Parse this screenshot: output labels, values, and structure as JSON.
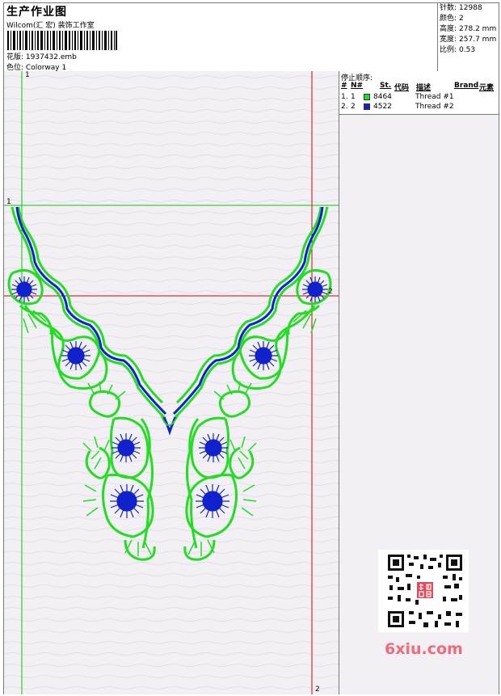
{
  "header": {
    "title": "生产作业图",
    "subtitle": "Wilcom(汇 宏) 装饰工作室",
    "design_label": "花版:",
    "design_value": "1937432.emb",
    "colorway_label": "色位:",
    "colorway_value": "Colorway 1"
  },
  "stats": [
    {
      "label": "针数:",
      "value": "12988"
    },
    {
      "label": "颜色:",
      "value": "2"
    },
    {
      "label": "高度:",
      "value": "278.2 mm"
    },
    {
      "label": "宽度:",
      "value": "257.7 mm"
    },
    {
      "label": "比例:",
      "value": "0.53"
    }
  ],
  "stop_sequence": {
    "title": "停止顺序:",
    "columns": [
      "#",
      "N#",
      "St.",
      "代码",
      "描述",
      "Brand",
      "元素"
    ],
    "rows": [
      {
        "num": "1.",
        "n": "1",
        "code": "8464",
        "color": "#22dd22",
        "desc": "Thread #1"
      },
      {
        "num": "2.",
        "n": "2",
        "code": "4522",
        "color": "#1122cc",
        "desc": "Thread #2"
      }
    ]
  },
  "guides": {
    "vertical_top": "1",
    "horizontal_left": "1",
    "horizontal_right": "2",
    "vertical_bottom": "2"
  },
  "colors": {
    "green_thread": "#22dd22",
    "blue_thread": "#1122cc",
    "guide_green": "#00cc00",
    "guide_red": "#dd0000",
    "canvas_bg": "#f2f0f4"
  },
  "watermark": {
    "site": "6xiu.com",
    "seal_text": "汉图图库"
  }
}
